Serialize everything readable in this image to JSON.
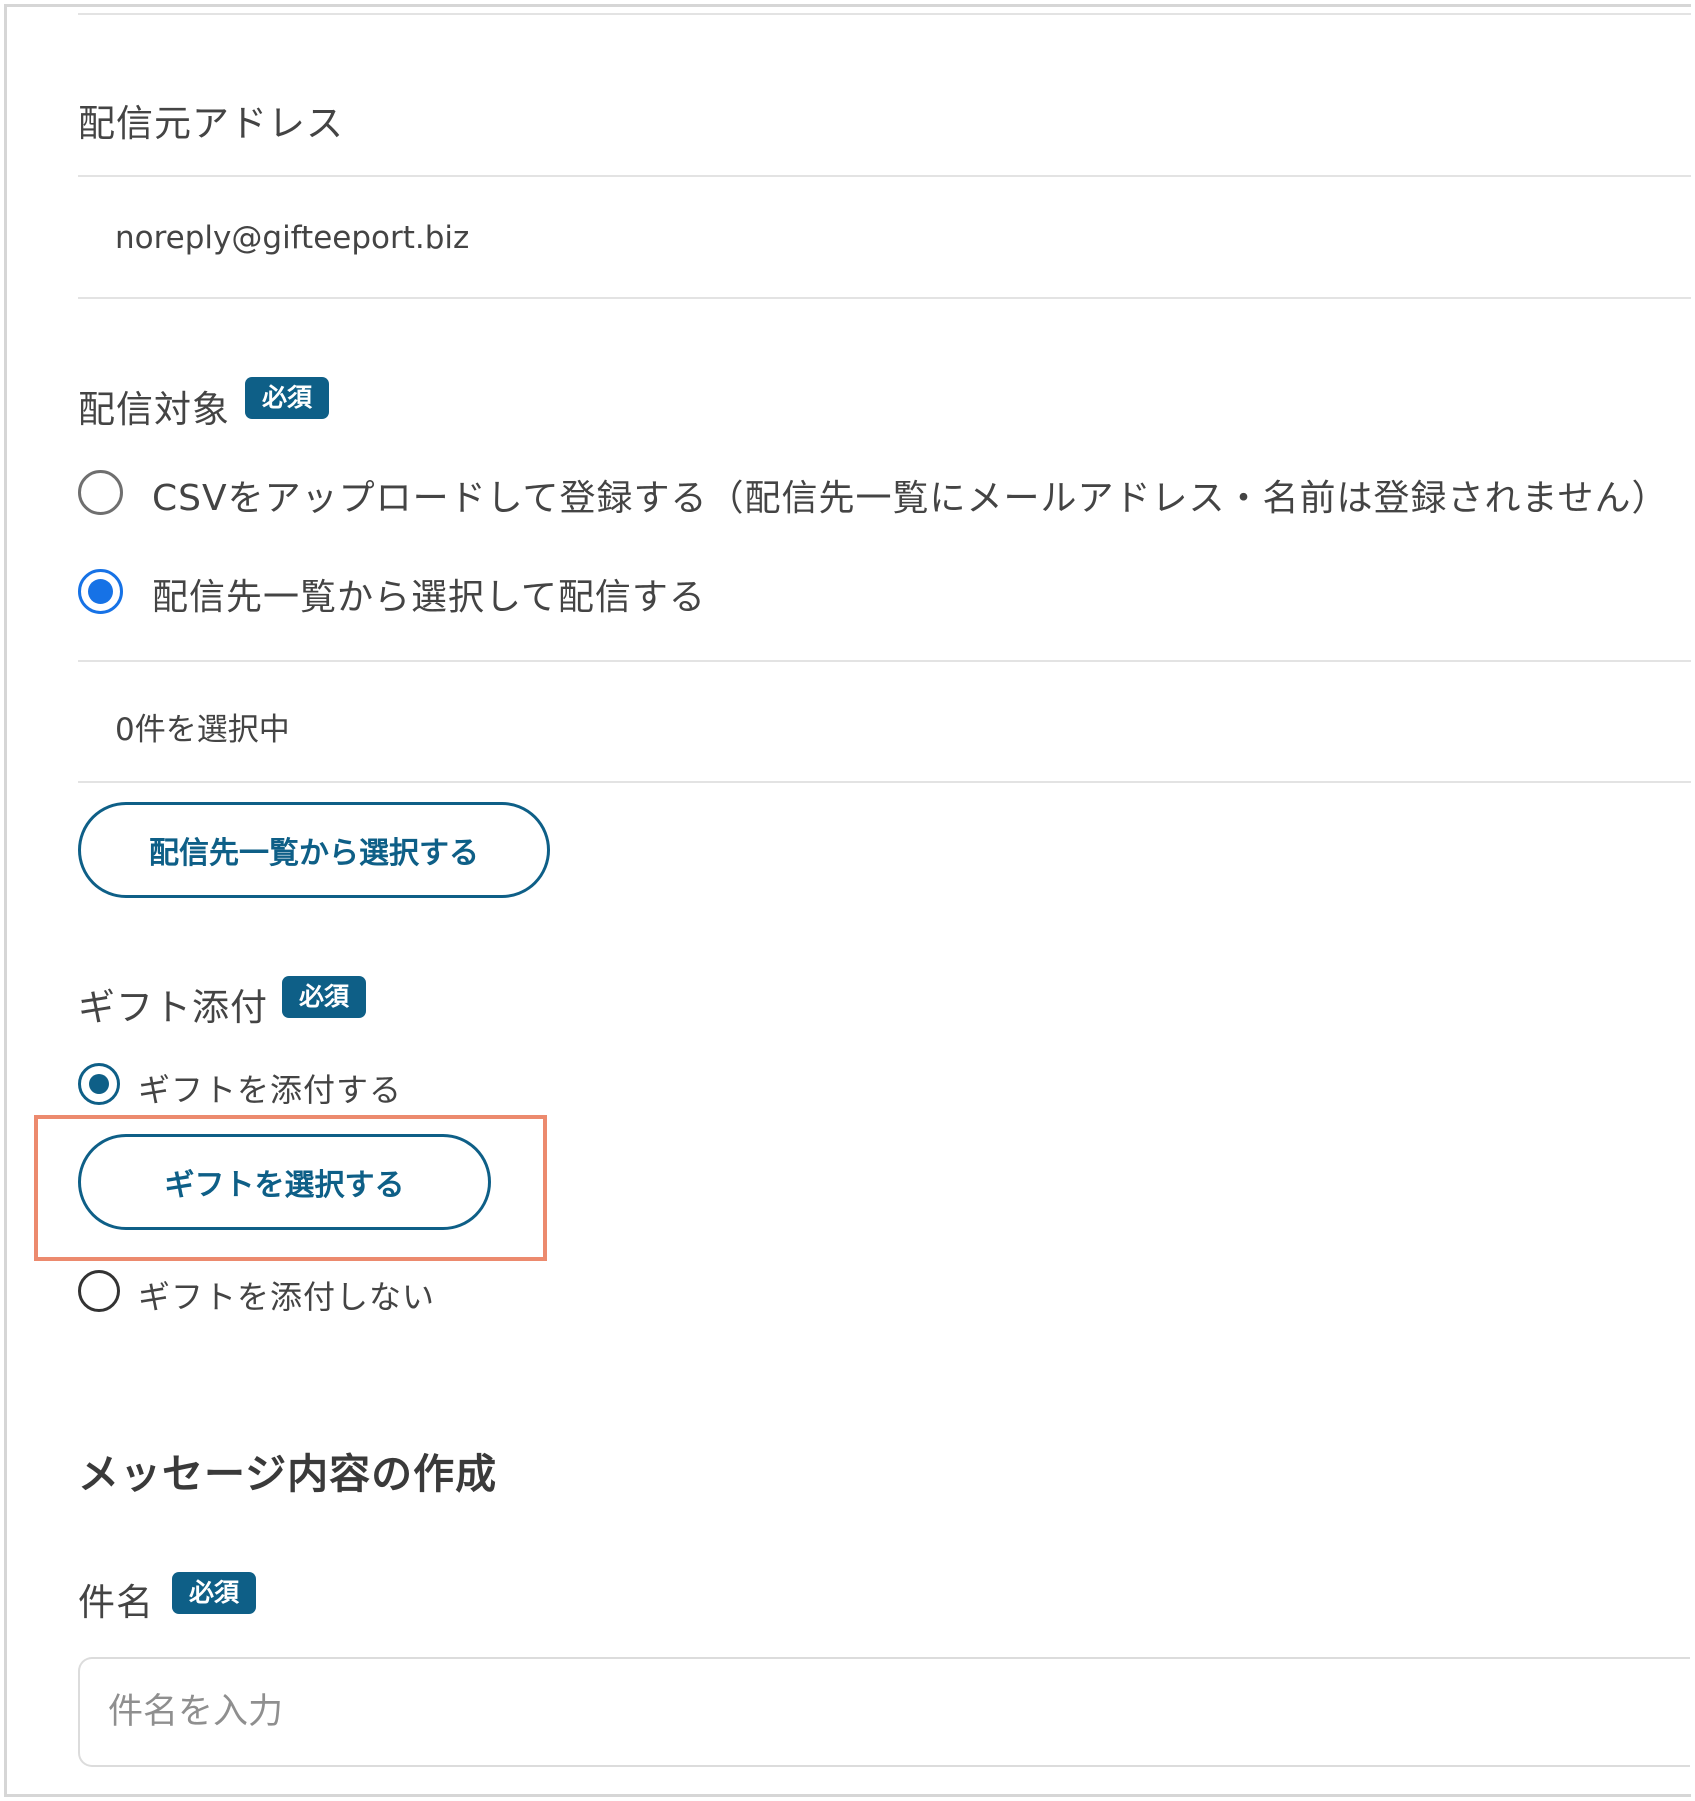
{
  "sender": {
    "label": "配信元アドレス",
    "value": "noreply@gifteeport.biz"
  },
  "target": {
    "label": "配信対象",
    "badge": "必須",
    "options": [
      {
        "label": "CSVをアップロードして登録する（配信先一覧にメールアドレス・名前は登録されません）",
        "selected": false
      },
      {
        "label": "配信先一覧から選択して配信する",
        "selected": true
      }
    ],
    "selected_count": "0件を選択中",
    "select_button": "配信先一覧から選択する"
  },
  "gift": {
    "label": "ギフト添付",
    "badge": "必須",
    "attach_option": "ギフトを添付する",
    "select_button": "ギフトを選択する",
    "no_attach_option": "ギフトを添付しない"
  },
  "message": {
    "section_title": "メッセージ内容の作成",
    "subject_label": "件名",
    "subject_badge": "必須",
    "subject_value": "",
    "subject_placeholder": "件名を入力"
  },
  "colors": {
    "brand": "#0e5f87",
    "radio_selected": "#1672e6",
    "highlight": "#ec8a6e"
  }
}
